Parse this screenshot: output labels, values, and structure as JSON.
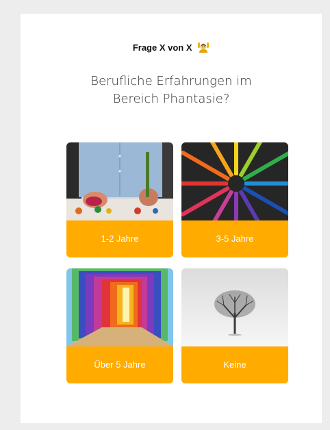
{
  "header": {
    "counter_text": "Frage X von X",
    "emoji_icon": "person-raising-hands-icon"
  },
  "question": {
    "text": "Berufliche Erfahrungen im\nBereich Phantasie?"
  },
  "options": [
    {
      "label": "1-2 Jahre",
      "image": "painting-hands-image"
    },
    {
      "label": "3-5 Jahre",
      "image": "colored-pencils-circle-image"
    },
    {
      "label": "Über 5 Jahre",
      "image": "rainbow-tunnel-image"
    },
    {
      "label": "Keine",
      "image": "lone-tree-image"
    }
  ],
  "colors": {
    "accent": "#ffab00",
    "background": "#ededed",
    "card": "#ffffff"
  }
}
